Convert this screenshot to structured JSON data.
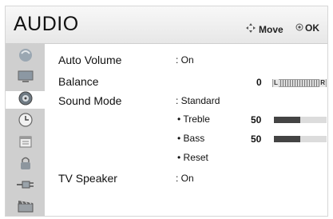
{
  "header": {
    "title": "AUDIO",
    "move_label": "Move",
    "ok_label": "OK"
  },
  "sidebar": {
    "items": [
      {
        "icon": "picture-icon",
        "active": false
      },
      {
        "icon": "monitor-icon",
        "active": false
      },
      {
        "icon": "audio-icon",
        "active": true
      },
      {
        "icon": "clock-icon",
        "active": false
      },
      {
        "icon": "calendar-icon",
        "active": false
      },
      {
        "icon": "lock-icon",
        "active": false
      },
      {
        "icon": "input-plug-icon",
        "active": false
      },
      {
        "icon": "clapperboard-icon",
        "active": false
      }
    ]
  },
  "menu": {
    "auto_volume": {
      "label": "Auto Volume",
      "value": ": On"
    },
    "balance": {
      "label": "Balance",
      "value": "0",
      "left_label": "L",
      "right_label": "R"
    },
    "sound_mode": {
      "label": "Sound Mode",
      "value": ": Standard",
      "treble": {
        "label": "• Treble",
        "value": "50",
        "level": 0.5
      },
      "bass": {
        "label": "• Bass",
        "value": "50",
        "level": 0.5
      },
      "reset": {
        "label": "• Reset"
      }
    },
    "tv_speaker": {
      "label": "TV Speaker",
      "value": ": On"
    }
  }
}
